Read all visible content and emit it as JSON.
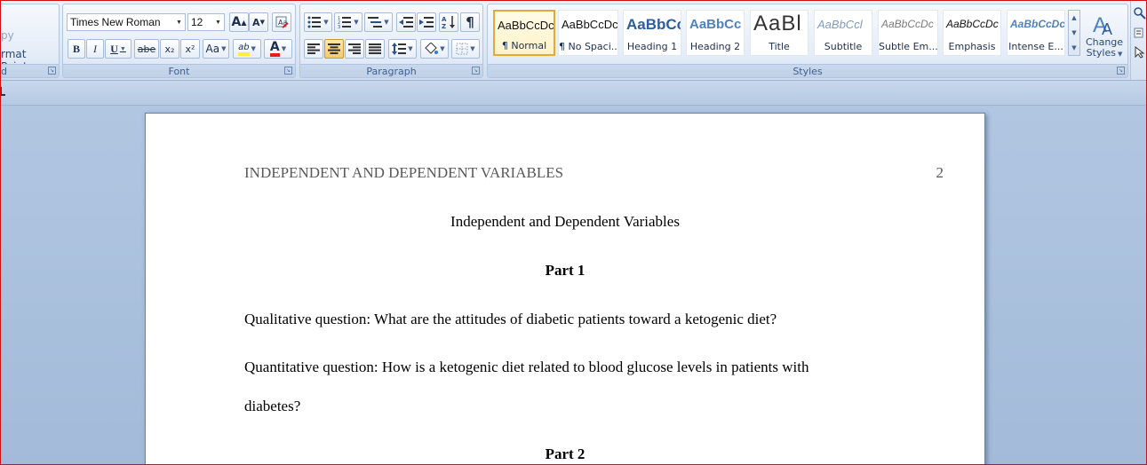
{
  "clipboard": {
    "copy_label": "py",
    "format_painter_label": "rmat Painter",
    "group_label": "d"
  },
  "font": {
    "name": "Times New Roman",
    "size": "12",
    "bold": "B",
    "italic": "I",
    "underline": "U",
    "strikethrough": "abe",
    "subscript": "x₂",
    "superscript": "x²",
    "change_case": "Aa",
    "grow": "A",
    "shrink": "A",
    "highlight": "ab",
    "font_color": "A",
    "group_label": "Font"
  },
  "paragraph": {
    "group_label": "Paragraph",
    "show_marks": "¶",
    "sort": "A↓Z"
  },
  "styles": {
    "group_label": "Styles",
    "items": [
      {
        "sample": "AaBbCcDc",
        "name": "¶ Normal"
      },
      {
        "sample": "AaBbCcDc",
        "name": "¶ No Spaci..."
      },
      {
        "sample": "AaBbCc",
        "name": "Heading 1"
      },
      {
        "sample": "AaBbCc",
        "name": "Heading 2"
      },
      {
        "sample": "AaBl",
        "name": "Title"
      },
      {
        "sample": "AaBbCcl",
        "name": "Subtitle"
      },
      {
        "sample": "AaBbCcDc",
        "name": "Subtle Em..."
      },
      {
        "sample": "AaBbCcDc",
        "name": "Emphasis"
      },
      {
        "sample": "AaBbCcDc",
        "name": "Intense E..."
      }
    ],
    "change_styles_line1": "Change",
    "change_styles_line2": "Styles"
  },
  "document": {
    "running_head": "INDEPENDENT AND DEPENDENT VARIABLES",
    "page_number": "2",
    "title": "Independent and Dependent Variables",
    "part1": "Part 1",
    "qualitative": "Qualitative question: What are the attitudes of diabetic patients toward a ketogenic diet?",
    "quantitative_line1": "Quantitative question: How is a ketogenic diet related to blood glucose levels in patients with",
    "quantitative_line2": "diabetes?",
    "part2": "Part 2"
  },
  "colors": {
    "ribbon_label": "#3e5f8f",
    "selected_style": "#e5a93b",
    "heading_blue": "#2f5c9a",
    "running_head": "#595959"
  }
}
